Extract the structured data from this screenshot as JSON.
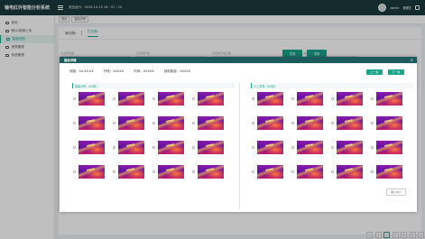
{
  "app": {
    "title": "输电红外智能分析系统",
    "clock": "安全运行：2019-10-15  16 : 07 : 25"
  },
  "header": {
    "user": "admin",
    "role": "管理员"
  },
  "sidebar": {
    "items": [
      {
        "label": "首页",
        "icon": "home-icon",
        "active": false
      },
      {
        "label": "图片/视频上传",
        "icon": "upload-icon",
        "active": false
      },
      {
        "label": "智能识别",
        "icon": "scan-icon",
        "active": true
      },
      {
        "label": "报表管理",
        "icon": "report-icon",
        "active": false
      },
      {
        "label": "系统管理",
        "icon": "gear-icon",
        "active": false
      }
    ]
  },
  "breadcrumb": {
    "home": "首页",
    "current": "智能识别"
  },
  "tabs": [
    "未分析",
    "已分析"
  ],
  "filters": [
    "请选择线路",
    "请选择杆塔",
    "请选择开始日期",
    "请选择结束日期"
  ],
  "actions": {
    "search": "查询",
    "reset": "重置"
  },
  "pagination": {
    "prev": "<",
    "next": ">",
    "pages": [
      "1",
      "2",
      "3",
      "4",
      "5"
    ],
    "current": "2",
    "page_size": "10"
  },
  "modal": {
    "title": "验收详情",
    "close": "×",
    "info": {
      "line": "线路：XX-XX-XX",
      "tower": "杆塔：XXXXX",
      "time": "时间：XXXXX",
      "count": "缺陷数量：XXXXX"
    },
    "prev_button": "上一条",
    "next_button": "下一条",
    "left_group_label": "智能识别（XX张）",
    "right_group_label": "人工复核（XX张）",
    "footer_button": "确认统计"
  },
  "colors": {
    "accent": "#1aa58c",
    "topbar": "#1b3a3d",
    "modal_header": "#1b5a5d"
  }
}
